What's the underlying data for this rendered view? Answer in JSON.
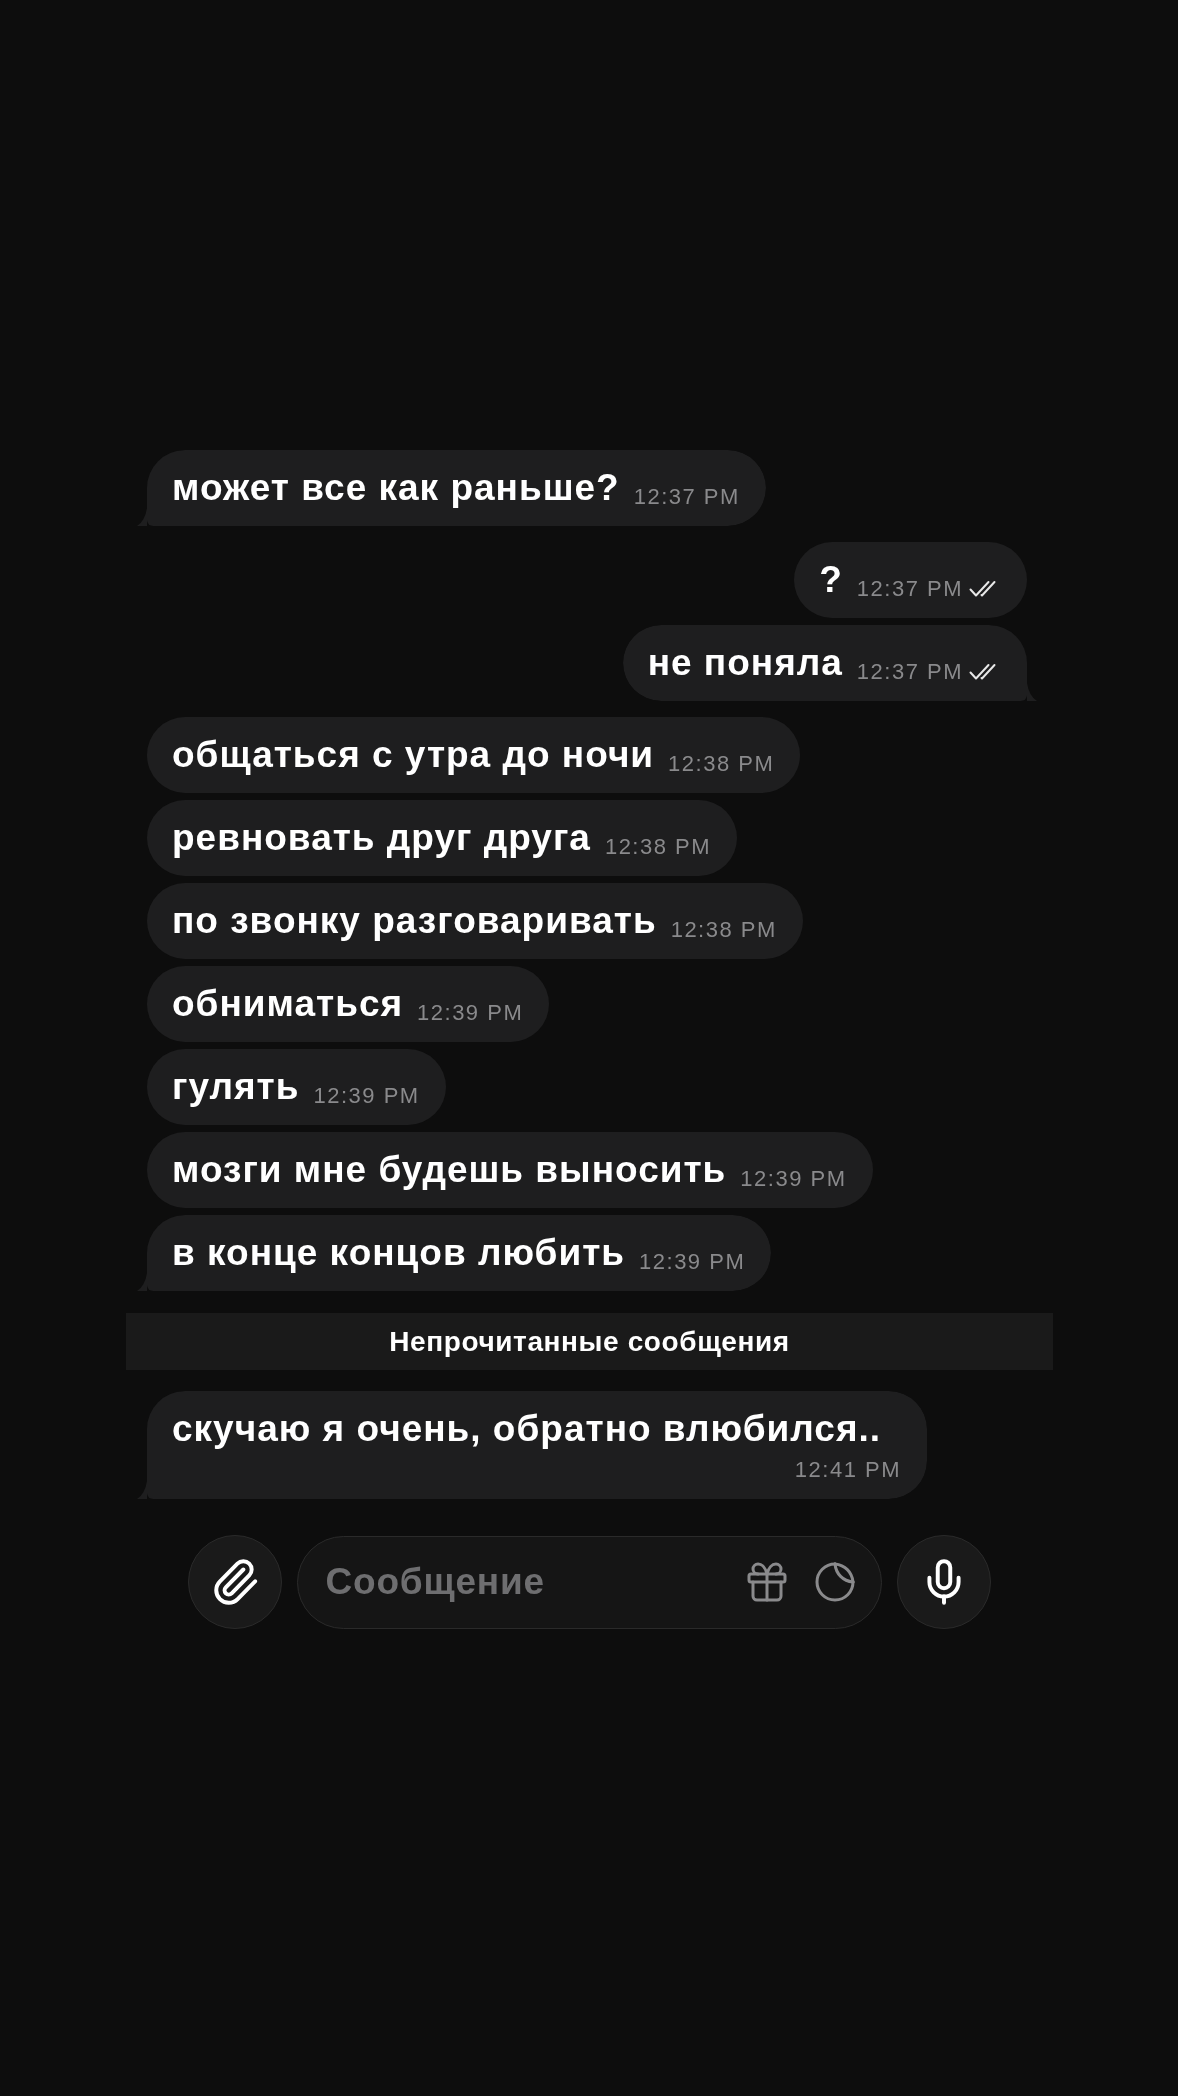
{
  "messages": [
    {
      "kind": "incoming",
      "text": "может все как раньше?",
      "time": "12:37 PM"
    },
    {
      "kind": "outgoing",
      "text": "?",
      "time": "12:37 PM",
      "read": true
    },
    {
      "kind": "outgoing",
      "text": "не поняла",
      "time": "12:37 PM",
      "read": true
    },
    {
      "kind": "incoming",
      "text": "общаться с утра до ночи",
      "time": "12:38 PM"
    },
    {
      "kind": "incoming",
      "text": "ревновать друг друга",
      "time": "12:38 PM"
    },
    {
      "kind": "incoming",
      "text": "по звонку разговаривать",
      "time": "12:38 PM"
    },
    {
      "kind": "incoming",
      "text": "обниматься",
      "time": "12:39 PM"
    },
    {
      "kind": "incoming",
      "text": "гулять",
      "time": "12:39 PM"
    },
    {
      "kind": "incoming",
      "text": "мозги мне будешь выносить",
      "time": "12:39 PM"
    },
    {
      "kind": "incoming",
      "text": "в конце концов любить",
      "time": "12:39 PM"
    },
    {
      "kind": "unread_divider",
      "label": "Непрочитанные сообщения"
    },
    {
      "kind": "incoming",
      "text": "скучаю я очень, обратно влюбился..",
      "time": "12:41 PM"
    }
  ],
  "composer": {
    "placeholder": "Сообщение"
  }
}
